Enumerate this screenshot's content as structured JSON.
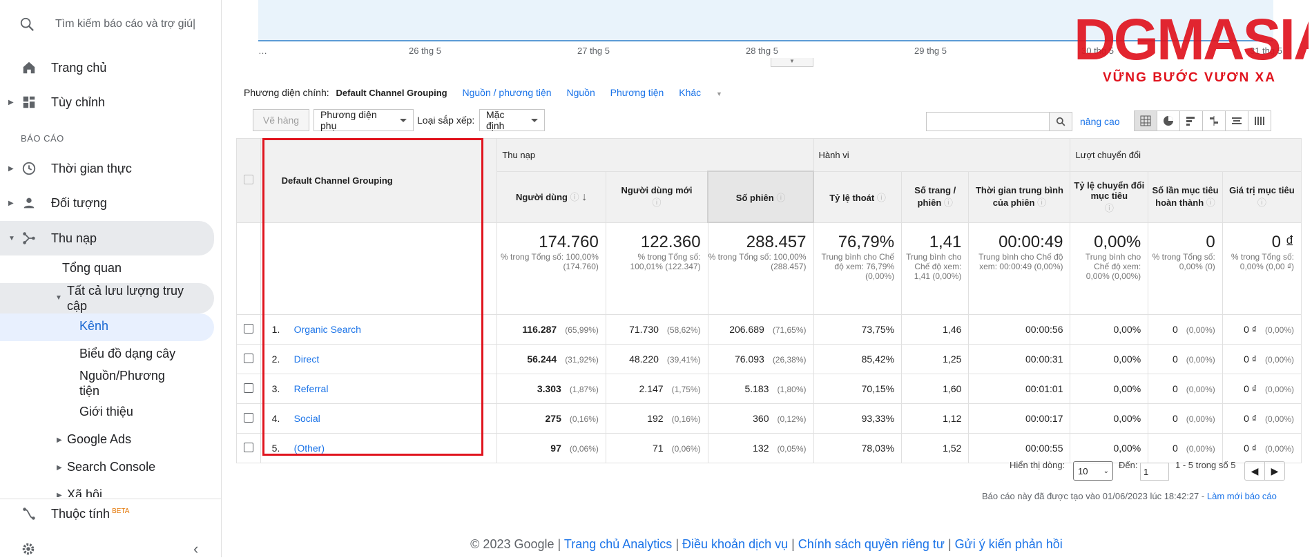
{
  "search": {
    "placeholder": "Tìm kiếm báo cáo và trợ giú|"
  },
  "sidebar": {
    "home": "Trang chủ",
    "customize": "Tùy chỉnh",
    "section_reports": "BÁO CÁO",
    "realtime": "Thời gian thực",
    "audience": "Đối tượng",
    "acquisition": "Thu nạp",
    "overview": "Tổng quan",
    "all_traffic": "Tất cả lưu lượng truy cập",
    "channels": "Kênh",
    "treemap": "Biểu đồ dạng cây",
    "source_medium": "Nguồn/Phương tiện",
    "referrals": "Giới thiệu",
    "google_ads": "Google Ads",
    "search_console": "Search Console",
    "social": "Xã hội",
    "attribution": "Thuộc tính",
    "beta": "BETA"
  },
  "chart": {
    "ticks": [
      "…",
      "26 thg 5",
      "27 thg 5",
      "28 thg 5",
      "29 thg 5",
      "30 thg 5",
      "31 thg 5"
    ]
  },
  "dims": {
    "label": "Phương diện chính:",
    "active": "Default Channel Grouping",
    "opt1": "Nguồn / phương tiện",
    "opt2": "Nguồn",
    "opt3": "Phương tiện",
    "opt4": "Khác"
  },
  "toolbar": {
    "plot_rows": "Vẽ hàng",
    "secondary_dim": "Phương diện phụ",
    "sort_label": "Loại sắp xếp:",
    "sort_value": "Mặc định",
    "advanced": "nâng cao"
  },
  "table": {
    "dim_header": "Default Channel Grouping",
    "groups": [
      "Thu nạp",
      "Hành vi",
      "Lượt chuyển đổi"
    ],
    "columns": [
      "Người dùng",
      "Người dùng mới",
      "Số phiên",
      "Tỷ lệ thoát",
      "Số trang / phiên",
      "Thời gian trung bình của phiên",
      "Tỷ lệ chuyển đổi mục tiêu",
      "Số lần mục tiêu hoàn thành",
      "Giá trị mục tiêu"
    ],
    "totals": [
      {
        "big": "174.760",
        "small": "% trong Tổng số: 100,00% (174.760)"
      },
      {
        "big": "122.360",
        "small": "% trong Tổng số: 100,01% (122.347)"
      },
      {
        "big": "288.457",
        "small": "% trong Tổng số: 100,00% (288.457)"
      },
      {
        "big": "76,79%",
        "small": "Trung bình cho Chế độ xem: 76,79% (0,00%)"
      },
      {
        "big": "1,41",
        "small": "Trung bình cho Chế độ xem: 1,41 (0,00%)"
      },
      {
        "big": "00:00:49",
        "small": "Trung bình cho Chế độ xem: 00:00:49 (0,00%)"
      },
      {
        "big": "0,00%",
        "small": "Trung bình cho Chế độ xem: 0,00% (0,00%)"
      },
      {
        "big": "0",
        "small": "% trong Tổng số: 0,00% (0)"
      },
      {
        "big": "0 ₫",
        "small": "% trong Tổng số: 0,00% (0,00 ₫)"
      }
    ],
    "rows": [
      {
        "idx": "1.",
        "name": "Organic Search",
        "users": "116.287",
        "users_pct": "(65,99%)",
        "new": "71.730",
        "new_pct": "(58,62%)",
        "sess": "206.689",
        "sess_pct": "(71,65%)",
        "bounce": "73,75%",
        "pps": "1,46",
        "dur": "00:00:56",
        "conv": "0,00%",
        "goals": "0",
        "goals_pct": "(0,00%)",
        "val": "0 ₫",
        "val_pct": "(0,00%)"
      },
      {
        "idx": "2.",
        "name": "Direct",
        "users": "56.244",
        "users_pct": "(31,92%)",
        "new": "48.220",
        "new_pct": "(39,41%)",
        "sess": "76.093",
        "sess_pct": "(26,38%)",
        "bounce": "85,42%",
        "pps": "1,25",
        "dur": "00:00:31",
        "conv": "0,00%",
        "goals": "0",
        "goals_pct": "(0,00%)",
        "val": "0 ₫",
        "val_pct": "(0,00%)"
      },
      {
        "idx": "3.",
        "name": "Referral",
        "users": "3.303",
        "users_pct": "(1,87%)",
        "new": "2.147",
        "new_pct": "(1,75%)",
        "sess": "5.183",
        "sess_pct": "(1,80%)",
        "bounce": "70,15%",
        "pps": "1,60",
        "dur": "00:01:01",
        "conv": "0,00%",
        "goals": "0",
        "goals_pct": "(0,00%)",
        "val": "0 ₫",
        "val_pct": "(0,00%)"
      },
      {
        "idx": "4.",
        "name": "Social",
        "users": "275",
        "users_pct": "(0,16%)",
        "new": "192",
        "new_pct": "(0,16%)",
        "sess": "360",
        "sess_pct": "(0,12%)",
        "bounce": "93,33%",
        "pps": "1,12",
        "dur": "00:00:17",
        "conv": "0,00%",
        "goals": "0",
        "goals_pct": "(0,00%)",
        "val": "0 ₫",
        "val_pct": "(0,00%)"
      },
      {
        "idx": "5.",
        "name": "(Other)",
        "users": "97",
        "users_pct": "(0,06%)",
        "new": "71",
        "new_pct": "(0,06%)",
        "sess": "132",
        "sess_pct": "(0,05%)",
        "bounce": "78,03%",
        "pps": "1,52",
        "dur": "00:00:55",
        "conv": "0,00%",
        "goals": "0",
        "goals_pct": "(0,00%)",
        "val": "0 ₫",
        "val_pct": "(0,00%)"
      }
    ]
  },
  "pager": {
    "show_rows": "Hiển thị dòng:",
    "rows_value": "10",
    "goto": "Đến:",
    "goto_value": "1",
    "range": "1 - 5 trong số 5"
  },
  "report_note": "Báo cáo này đã được tạo vào 01/06/2023 lúc 18:42:27 -",
  "refresh": "Làm mới báo cáo",
  "footer": {
    "copyright": "© 2023 Google",
    "l1": "Trang chủ Analytics",
    "l2": "Điều khoản dịch vụ",
    "l3": "Chính sách quyền riêng tư",
    "l4": "Gửi ý kiến phản hồi"
  },
  "logo": {
    "brand": "DGMASIA",
    "slogan": "VỮNG BƯỚC VƯƠN XA"
  },
  "colors": {
    "accent": "#1a73e8",
    "highlight": "#e0141e",
    "logo_red": "#e0141e"
  }
}
